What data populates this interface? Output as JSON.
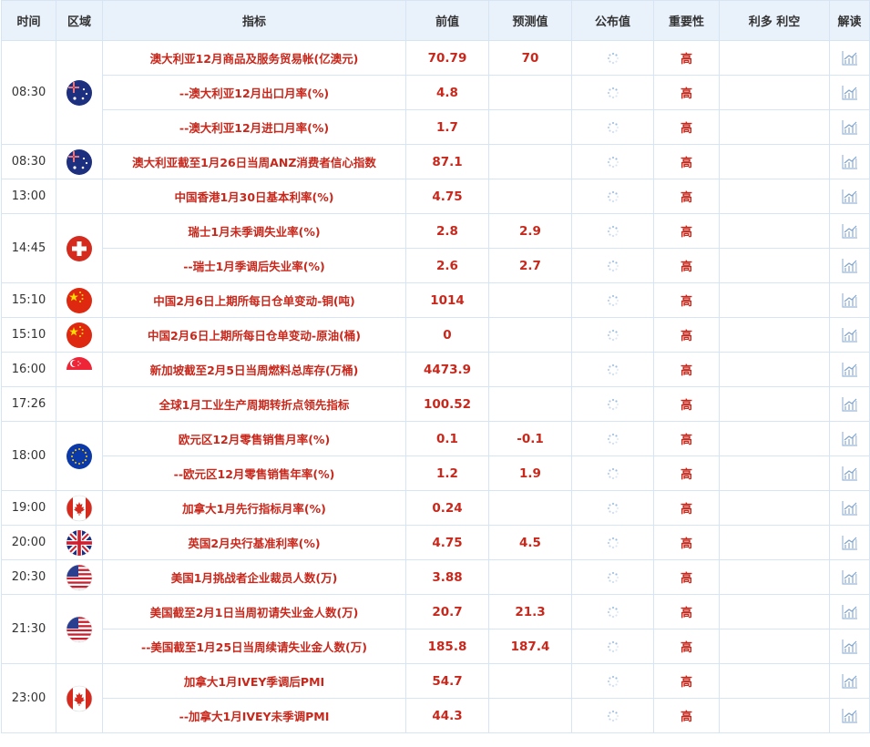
{
  "header": {
    "time": "时间",
    "region": "区域",
    "indicator": "指标",
    "previous": "前值",
    "forecast": "预测值",
    "actual": "公布值",
    "importance": "重要性",
    "effect": "利多 利空",
    "analysis": "解读"
  },
  "groups": [
    {
      "time": "08:30",
      "flag": "australia",
      "rows": [
        {
          "name": "澳大利亚12月商品及服务贸易帐(亿澳元)",
          "prev": "70.79",
          "fcst": "70",
          "imp": "高"
        },
        {
          "name": "--澳大利亚12月出口月率(%)",
          "prev": "4.8",
          "fcst": "",
          "imp": "高"
        },
        {
          "name": "--澳大利亚12月进口月率(%)",
          "prev": "1.7",
          "fcst": "",
          "imp": "高"
        }
      ]
    },
    {
      "time": "08:30",
      "flag": "australia",
      "rows": [
        {
          "name": "澳大利亚截至1月26日当周ANZ消费者信心指数",
          "prev": "87.1",
          "fcst": "",
          "imp": "高"
        }
      ]
    },
    {
      "time": "13:00",
      "flag": "",
      "rows": [
        {
          "name": "中国香港1月30日基本利率(%)",
          "prev": "4.75",
          "fcst": "",
          "imp": "高"
        }
      ]
    },
    {
      "time": "14:45",
      "flag": "switzerland",
      "rows": [
        {
          "name": "瑞士1月未季调失业率(%)",
          "prev": "2.8",
          "fcst": "2.9",
          "imp": "高"
        },
        {
          "name": "--瑞士1月季调后失业率(%)",
          "prev": "2.6",
          "fcst": "2.7",
          "imp": "高"
        }
      ]
    },
    {
      "time": "15:10",
      "flag": "china",
      "rows": [
        {
          "name": "中国2月6日上期所每日仓单变动-铜(吨)",
          "prev": "1014",
          "fcst": "",
          "imp": "高"
        }
      ]
    },
    {
      "time": "15:10",
      "flag": "china",
      "rows": [
        {
          "name": "中国2月6日上期所每日仓单变动-原油(桶)",
          "prev": "0",
          "fcst": "",
          "imp": "高"
        }
      ]
    },
    {
      "time": "16:00",
      "flag": "singapore",
      "rows": [
        {
          "name": "新加坡截至2月5日当周燃料总库存(万桶)",
          "prev": "4473.9",
          "fcst": "",
          "imp": "高"
        }
      ]
    },
    {
      "time": "17:26",
      "flag": "",
      "rows": [
        {
          "name": "全球1月工业生产周期转折点领先指标",
          "prev": "100.52",
          "fcst": "",
          "imp": "高"
        }
      ]
    },
    {
      "time": "18:00",
      "flag": "eu",
      "rows": [
        {
          "name": "欧元区12月零售销售月率(%)",
          "prev": "0.1",
          "fcst": "-0.1",
          "imp": "高"
        },
        {
          "name": "--欧元区12月零售销售年率(%)",
          "prev": "1.2",
          "fcst": "1.9",
          "imp": "高"
        }
      ]
    },
    {
      "time": "19:00",
      "flag": "canada",
      "rows": [
        {
          "name": "加拿大1月先行指标月率(%)",
          "prev": "0.24",
          "fcst": "",
          "imp": "高"
        }
      ]
    },
    {
      "time": "20:00",
      "flag": "uk",
      "rows": [
        {
          "name": "英国2月央行基准利率(%)",
          "prev": "4.75",
          "fcst": "4.5",
          "imp": "高"
        }
      ]
    },
    {
      "time": "20:30",
      "flag": "usa",
      "rows": [
        {
          "name": "美国1月挑战者企业裁员人数(万)",
          "prev": "3.88",
          "fcst": "",
          "imp": "高"
        }
      ]
    },
    {
      "time": "21:30",
      "flag": "usa",
      "rows": [
        {
          "name": "美国截至2月1日当周初请失业金人数(万)",
          "prev": "20.7",
          "fcst": "21.3",
          "imp": "高"
        },
        {
          "name": "--美国截至1月25日当周续请失业金人数(万)",
          "prev": "185.8",
          "fcst": "187.4",
          "imp": "高"
        }
      ]
    },
    {
      "time": "23:00",
      "flag": "canada",
      "rows": [
        {
          "name": "加拿大1月IVEY季调后PMI",
          "prev": "54.7",
          "fcst": "",
          "imp": "高"
        },
        {
          "name": "--加拿大1月IVEY未季调PMI",
          "prev": "44.3",
          "fcst": "",
          "imp": "高"
        }
      ]
    }
  ],
  "colors": {
    "accent": "#c8281c",
    "header_bg": "#e9f1fb",
    "border": "#d6e4f3"
  },
  "icons": {
    "pending": "loading-spinner-icon",
    "analysis": "chart-analysis-icon"
  }
}
